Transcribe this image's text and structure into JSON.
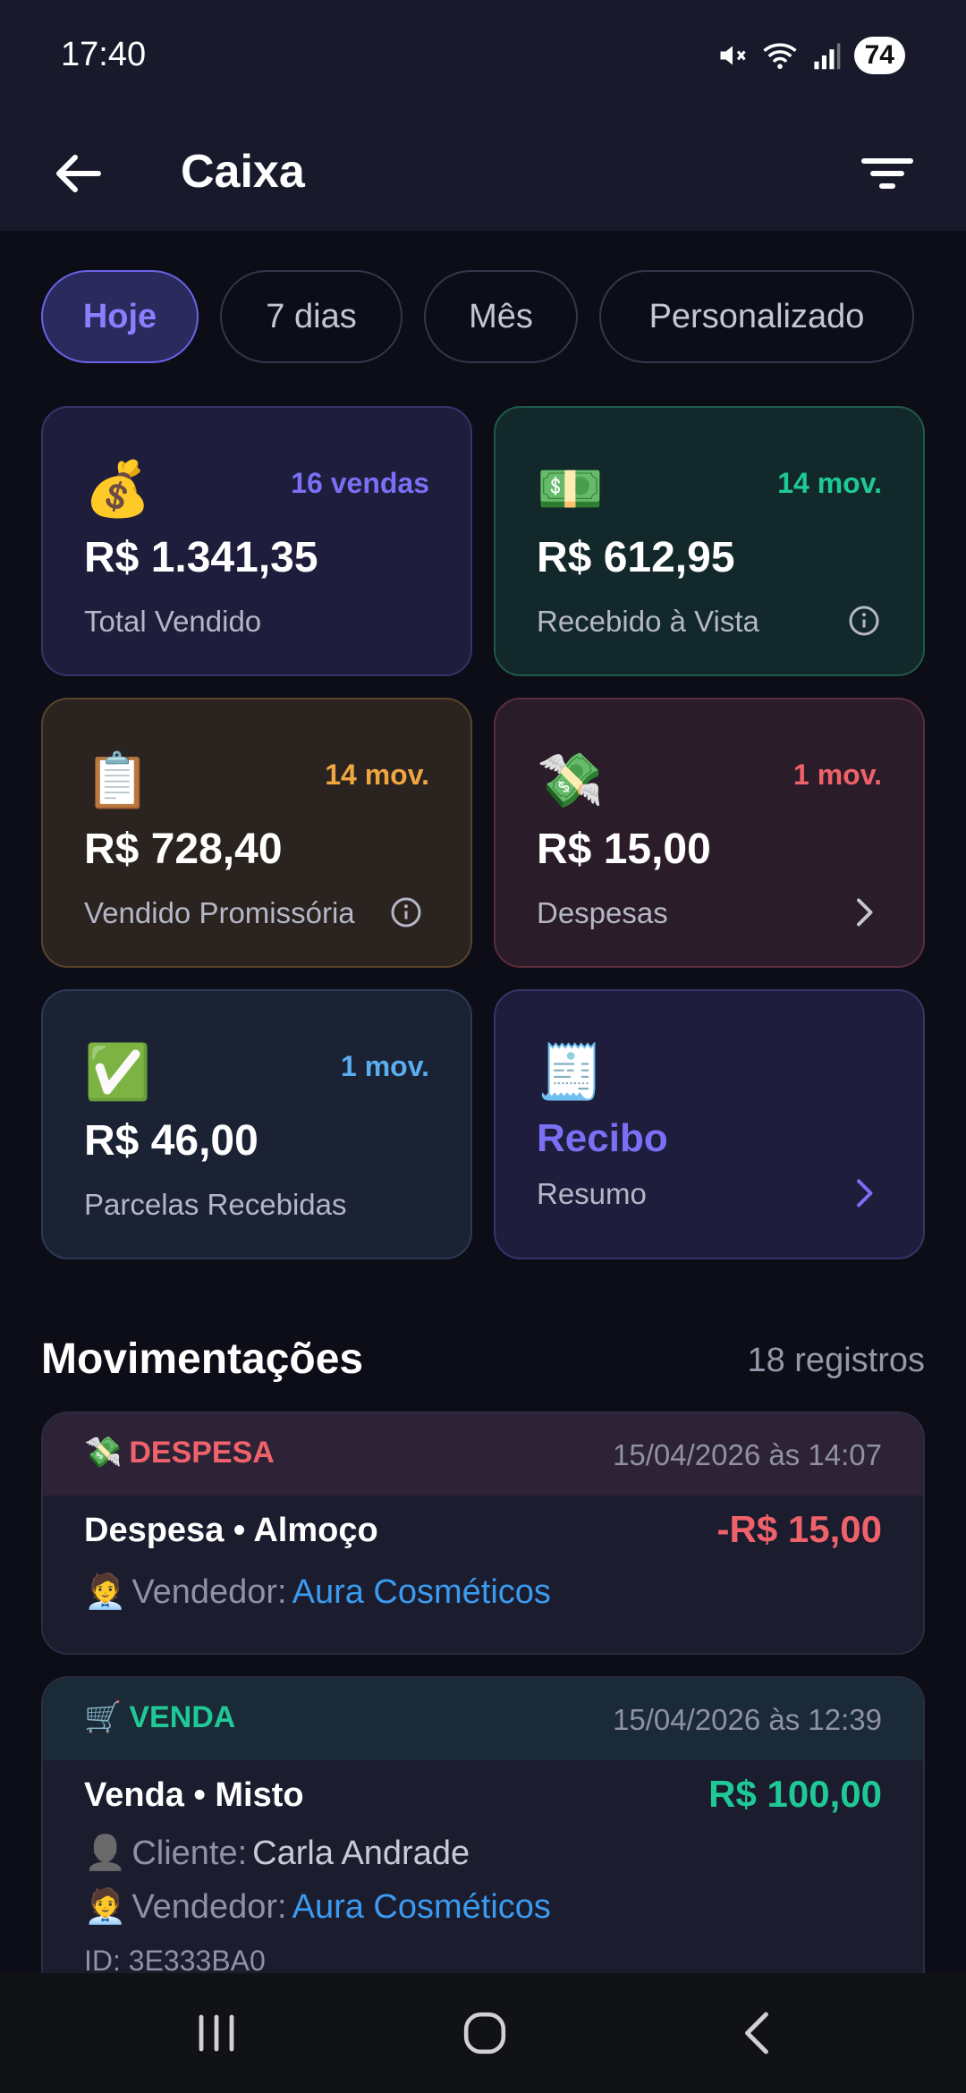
{
  "status": {
    "time": "17:40",
    "battery": "74"
  },
  "header": {
    "title": "Caixa"
  },
  "filters": [
    {
      "label": "Hoje",
      "active": true
    },
    {
      "label": "7 dias"
    },
    {
      "label": "Mês"
    },
    {
      "label": "Personalizado"
    }
  ],
  "cards": {
    "total_vendido": {
      "emoji": "💰",
      "count": "16 vendas",
      "amount": "R$ 1.341,35",
      "label": "Total Vendido"
    },
    "recebido_vista": {
      "emoji": "💵",
      "count": "14 mov.",
      "amount": "R$ 612,95",
      "label": "Recebido à Vista"
    },
    "promissoria": {
      "emoji": "📋",
      "count": "14 mov.",
      "amount": "R$ 728,40",
      "label": "Vendido Promissória"
    },
    "despesas": {
      "emoji": "💸",
      "count": "1 mov.",
      "amount": "R$ 15,00",
      "label": "Despesas"
    },
    "parcelas": {
      "emoji": "✅",
      "count": "1 mov.",
      "amount": "R$ 46,00",
      "label": "Parcelas Recebidas"
    },
    "recibo": {
      "emoji": "🧾",
      "title": "Recibo",
      "label": "Resumo"
    }
  },
  "movements": {
    "title": "Movimentações",
    "count": "18 registros",
    "items": [
      {
        "icon": "💸",
        "type": "DESPESA",
        "date": "15/04/2026 às 14:07",
        "title": "Despesa • Almoço",
        "value": "-R$ 15,00",
        "seller_icon": "🧑‍💼",
        "seller_label": "Vendedor:",
        "seller": "Aura Cosméticos"
      },
      {
        "icon": "🛒",
        "type": "VENDA",
        "date": "15/04/2026 às 12:39",
        "title": "Venda • Misto",
        "value": "R$ 100,00",
        "client_icon": "👤",
        "client_label": "Cliente:",
        "client": "Carla Andrade",
        "seller_icon": "🧑‍💼",
        "seller_label": "Vendedor:",
        "seller": "Aura Cosméticos",
        "id_text": "ID: 3E333BA0"
      }
    ]
  },
  "colors": {
    "accent": "#7b6ff5",
    "green": "#1fc996",
    "orange": "#f0a640",
    "red": "#f0626a",
    "blue": "#5aaef0"
  }
}
